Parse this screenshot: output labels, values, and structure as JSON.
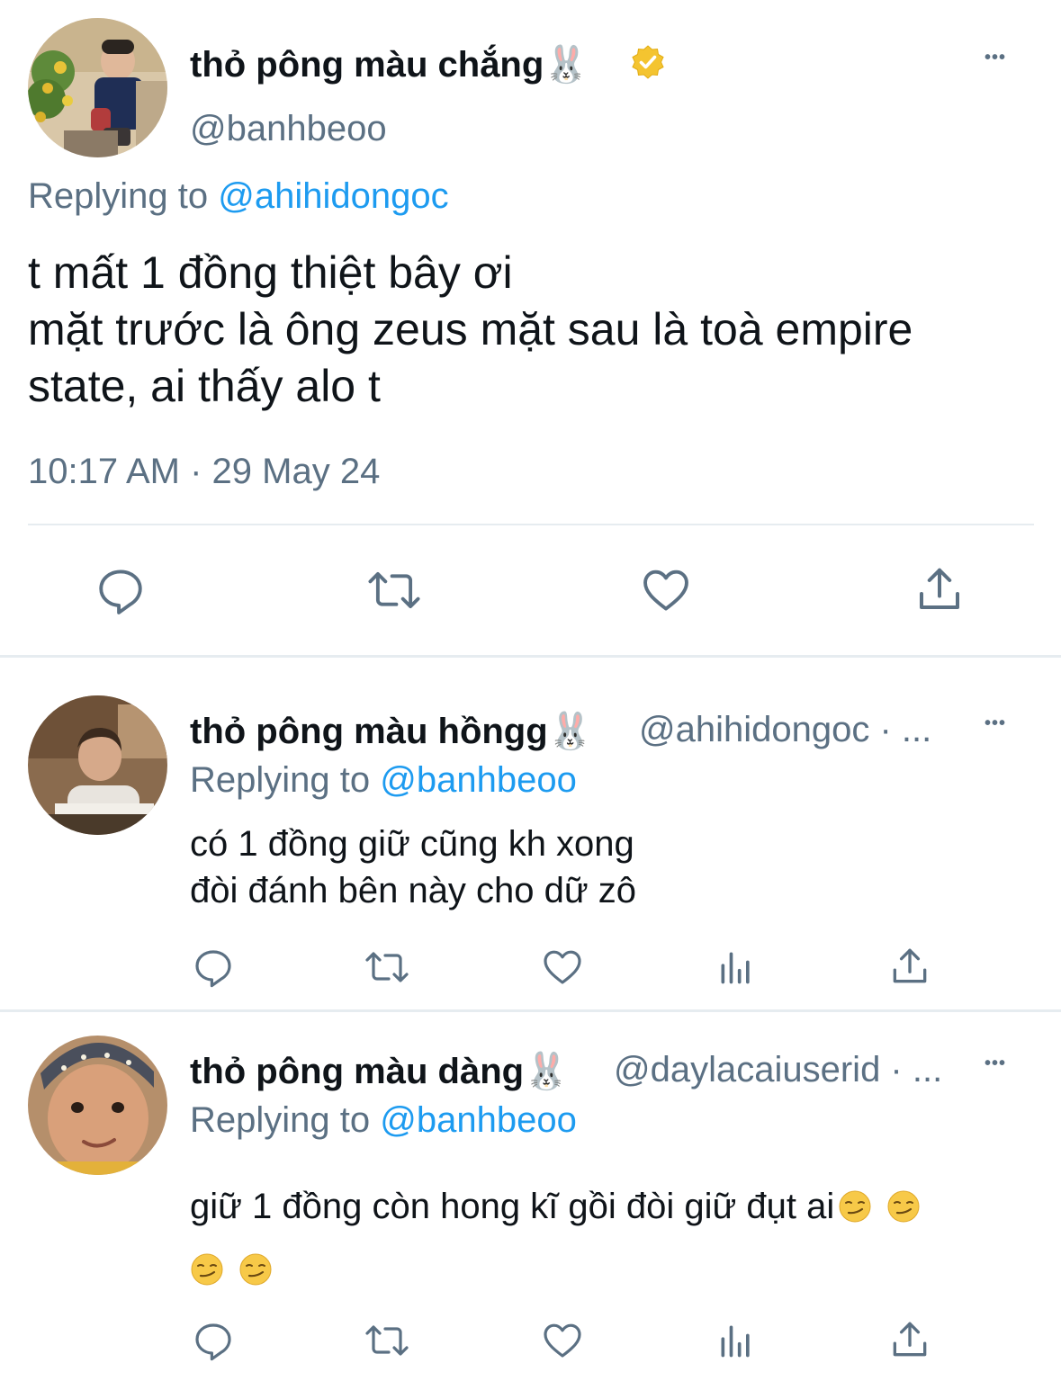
{
  "main_tweet": {
    "display_name": "thỏ pông màu chắng🐰",
    "handle": "@banhbeoo",
    "replying_prefix": "Replying to",
    "replying_to": "@ahihidongoc",
    "text_line1": "t mất 1 đồng thiệt bây ơi",
    "text_line2": "mặt trước là ông zeus mặt sau là toà empire",
    "text_line3": "state, ai thấy alo t",
    "timestamp": "10:17 AM · 29 May 24"
  },
  "replies": [
    {
      "display_name": "thỏ pông màu hồngg🐰",
      "handle_meta": "@ahihidongoc · ...",
      "replying_prefix": "Replying to",
      "replying_to": "@banhbeoo",
      "text_line1": "có 1 đồng giữ cũng kh xong",
      "text_line2": "đòi đánh bên này cho dữ zô"
    },
    {
      "display_name": "thỏ pông màu dàng🐰",
      "handle_meta": "@daylacaiuserid · ...",
      "replying_prefix": "Replying to",
      "replying_to": "@banhbeoo",
      "text_line1": "giữ 1 đồng còn hong kĩ gồi đòi giữ đụt ai",
      "emoji": "😏"
    }
  ],
  "more_glyph": "•••",
  "icons": [
    "reply-icon",
    "retweet-icon",
    "like-icon",
    "share-icon",
    "analytics-icon",
    "verified-badge-icon",
    "more-icon"
  ],
  "colors": {
    "text": "#0f1419",
    "muted": "#5b7083",
    "link": "#1d9bf0",
    "verified": "#f4c430",
    "divider": "#e6ecf0"
  }
}
